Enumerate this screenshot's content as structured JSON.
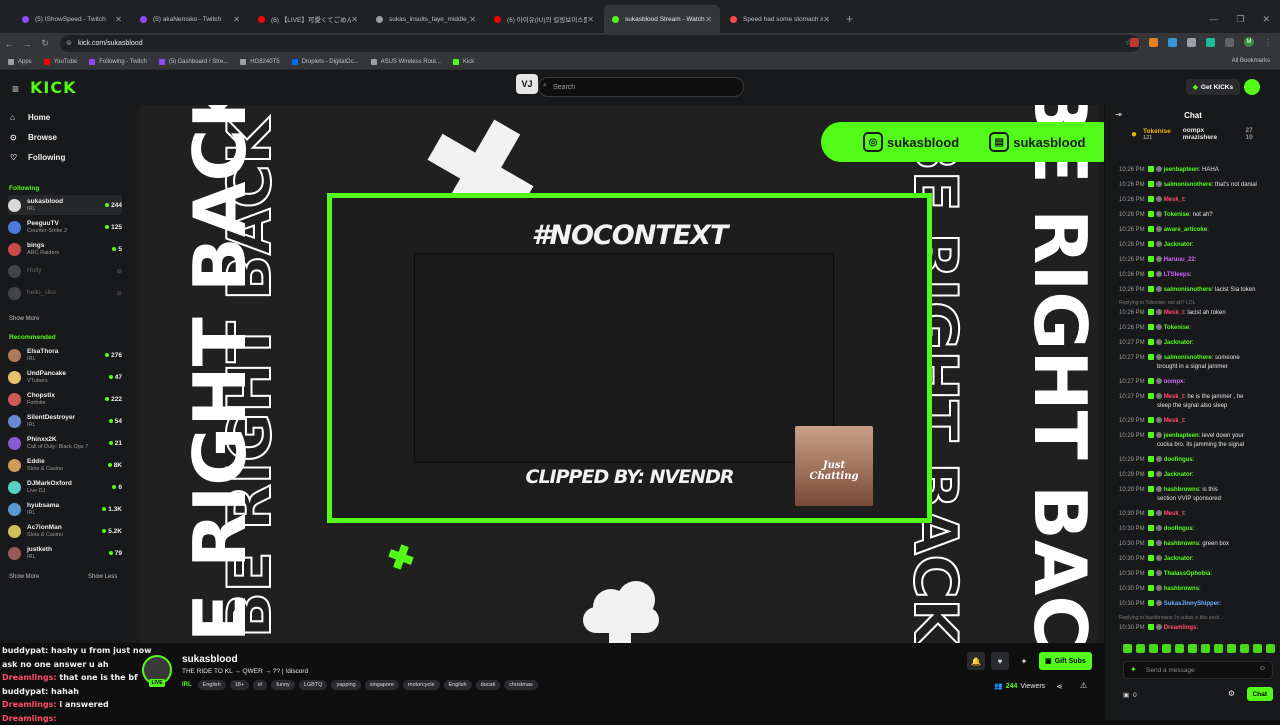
{
  "browser": {
    "tabs": [
      {
        "title": "(5) IShowSpeed - Twitch",
        "color": "#9146ff"
      },
      {
        "title": "(5) akaNemsko - Twitch",
        "color": "#9146ff"
      },
      {
        "title": "(6) 【LIVE】可愛くてごめん／花音聖...",
        "color": "#ff0000"
      },
      {
        "title": "sukas_insults_faye_middle_fing...",
        "color": "#9aa0a6"
      },
      {
        "title": "(6) 아이유(IU)의 킬링보이스를 ...",
        "color": "#ff0000"
      },
      {
        "title": "sukasblood Stream - Watch",
        "color": "#53fc18"
      },
      {
        "title": "Speed had some stomach issue...",
        "color": "#ff4b4b"
      }
    ],
    "url": "kick.com/sukasblood",
    "bookmarks": [
      "Apps",
      "YouTube",
      "Following - Twitch",
      "(5) Dashboard / Stre...",
      "HG8240T5",
      "Droplets - DigitalOc...",
      "ASUS Wireless Rout...",
      "Kick"
    ],
    "all_bookmarks": "All Bookmarks",
    "profile_initial": "M"
  },
  "topnav": {
    "logo": "KICK",
    "vj": "VJ",
    "search_placeholder": "Search",
    "get_kicks": "Get KICKs"
  },
  "sidebar": {
    "nav": [
      {
        "label": "Home",
        "icon": "home-icon"
      },
      {
        "label": "Browse",
        "icon": "compass-icon"
      },
      {
        "label": "Following",
        "icon": "heart-icon"
      }
    ],
    "following_title": "Following",
    "following": [
      {
        "name": "sukasblood",
        "category": "IRL",
        "viewers": "244",
        "color": "#d9d9d9"
      },
      {
        "name": "PeeguuTV",
        "category": "Counter-Strike 2",
        "viewers": "125",
        "color": "#4a7bd8"
      },
      {
        "name": "bings",
        "category": "ARC Raiders",
        "viewers": "5",
        "color": "#c84a4a"
      },
      {
        "name": "Holly",
        "category": "",
        "viewers": "",
        "color": "#888888"
      },
      {
        "name": "hello_siko",
        "category": "",
        "viewers": "",
        "color": "#888888"
      }
    ],
    "show_more": "Show More",
    "recommended_title": "Recommended",
    "recommended": [
      {
        "name": "ElsaThora",
        "category": "IRL",
        "viewers": "276",
        "color": "#b07a5a"
      },
      {
        "name": "UndPancake",
        "category": "VTubers",
        "viewers": "47",
        "color": "#e8c26a"
      },
      {
        "name": "Chopstix",
        "category": "Fortnite",
        "viewers": "222",
        "color": "#d05a5a"
      },
      {
        "name": "SilentDestroyer",
        "category": "IRL",
        "viewers": "54",
        "color": "#6a8ad0"
      },
      {
        "name": "Phinxx2K",
        "category": "Call of Duty: Black Ops 7",
        "viewers": "21",
        "color": "#8a5ad0"
      },
      {
        "name": "Eddie",
        "category": "Slots & Casino",
        "viewers": "8K",
        "color": "#d09a5a"
      },
      {
        "name": "DJMarkOxford",
        "category": "Live DJ",
        "viewers": "6",
        "color": "#5ad0c0"
      },
      {
        "name": "hyubsama",
        "category": "IRL",
        "viewers": "1.3K",
        "color": "#5a9ad0"
      },
      {
        "name": "Ac7ionMan",
        "category": "Slots & Casino",
        "viewers": "5.2K",
        "color": "#d0c05a"
      },
      {
        "name": "justketh",
        "category": "IRL",
        "viewers": "79",
        "color": "#9a5a5a"
      }
    ],
    "show_more_2": "Show More",
    "show_less": "Show Less"
  },
  "player": {
    "brb_text": "BE RIGHT BACK",
    "nocontext": "#NOCONTEXT",
    "clipped_by": "CLIPPED BY: NVENDR",
    "just_chatting": "Just Chatting",
    "social_instagram": "sukasblood",
    "social_twitch": "sukasblood"
  },
  "overlay_chat": [
    {
      "user": "buddypat:",
      "text": "hashy u from just now ask no one answer u ah",
      "user_color": "#f0f0f0"
    },
    {
      "user": "Dreamlings:",
      "text": "that one is the bf",
      "user_color": "#ff4b6b"
    },
    {
      "user": "buddypat:",
      "text": "hahah",
      "user_color": "#f0f0f0"
    },
    {
      "user": "Dreamlings:",
      "text": "i answered",
      "user_color": "#ff4b6b"
    },
    {
      "user": "Dreamlings:",
      "text": "",
      "user_color": "#ff4b6b"
    }
  ],
  "stream": {
    "live_badge": "LIVE",
    "channel": "sukasblood",
    "title": "THE RIDE TO KL → QWER → ?? | !discord",
    "category": "IRL",
    "tags": [
      "English",
      "18+",
      "irl",
      "funny",
      "LGBTQ",
      "yapping",
      "singapore",
      "motorcycle",
      "English",
      "ducati",
      "christmas"
    ],
    "gift_subs": "Gift Subs",
    "viewers": "244",
    "viewers_label": "Viewers"
  },
  "chat": {
    "title": "Chat",
    "pinned": [
      {
        "user": "Tokenise",
        "count": "121",
        "color": "#f4b400"
      },
      {
        "user": "oompx",
        "count": "27",
        "color": "#e6e6e6"
      },
      {
        "user": "mrazishere",
        "count": "10",
        "color": "#e6e6e6"
      }
    ],
    "messages": [
      {
        "type": "msg",
        "time": "10:26 PM",
        "user": "jeenbapteen",
        "color": "#53fc18",
        "text": "HAHA"
      },
      {
        "type": "msg",
        "time": "10:26 PM",
        "user": "salmonisnothere",
        "color": "#53fc18",
        "text": "that's not danial"
      },
      {
        "type": "msg",
        "time": "10:26 PM",
        "user": "Mesk_t",
        "color": "#ff4b6b",
        "text": ""
      },
      {
        "type": "msg",
        "time": "10:26 PM",
        "user": "Tokenise",
        "color": "#53fc18",
        "text": "not ah?"
      },
      {
        "type": "msg",
        "time": "10:26 PM",
        "user": "aware_articoke",
        "color": "#53fc18",
        "text": ""
      },
      {
        "type": "msg",
        "time": "10:26 PM",
        "user": "Jacknator",
        "color": "#53fc18",
        "text": ""
      },
      {
        "type": "msg",
        "time": "10:26 PM",
        "user": "Haruuu_22",
        "color": "#d06aff",
        "text": ""
      },
      {
        "type": "msg",
        "time": "10:26 PM",
        "user": "LTSleeps",
        "color": "#d06aff",
        "text": ""
      },
      {
        "type": "msg",
        "time": "10:26 PM",
        "user": "salmonisnothere",
        "color": "#53fc18",
        "text": "lacist Sia token"
      },
      {
        "type": "reply",
        "text": "Replying to Tokenise: not ah? LOL"
      },
      {
        "type": "msg",
        "time": "10:26 PM",
        "user": "Mesk_t",
        "color": "#ff4b6b",
        "text": "lacist ah token"
      },
      {
        "type": "msg",
        "time": "10:26 PM",
        "user": "Tokenise",
        "color": "#53fc18",
        "text": ""
      },
      {
        "type": "msg",
        "time": "10:27 PM",
        "user": "Jacknator",
        "color": "#53fc18",
        "text": ""
      },
      {
        "type": "msg",
        "time": "10:27 PM",
        "user": "salmonisnothere",
        "color": "#53fc18",
        "text": "someone"
      },
      {
        "type": "cont",
        "text": "brought in a signal jammer"
      },
      {
        "type": "msg",
        "time": "10:27 PM",
        "user": "oompx",
        "color": "#d06aff",
        "text": ""
      },
      {
        "type": "msg",
        "time": "10:27 PM",
        "user": "Mesk_t",
        "color": "#ff4b6b",
        "text": "he is the jammer , he"
      },
      {
        "type": "cont",
        "text": "sleep the signal also sleep"
      },
      {
        "type": "msg",
        "time": "10:29 PM",
        "user": "Mesk_t",
        "color": "#ff4b6b",
        "text": ""
      },
      {
        "type": "msg",
        "time": "10:29 PM",
        "user": "jeenbapteen",
        "color": "#53fc18",
        "text": "level down your"
      },
      {
        "type": "cont",
        "text": "cocka bro. its jamming the signal"
      },
      {
        "type": "msg",
        "time": "10:29 PM",
        "user": "doofingus",
        "color": "#53fc18",
        "text": ""
      },
      {
        "type": "msg",
        "time": "10:29 PM",
        "user": "Jacknator",
        "color": "#53fc18",
        "text": ""
      },
      {
        "type": "msg",
        "time": "10:29 PM",
        "user": "hashbrowns",
        "color": "#53fc18",
        "text": "is this"
      },
      {
        "type": "cont",
        "text": "section VVIP sponsored"
      },
      {
        "type": "msg",
        "time": "10:30 PM",
        "user": "Mesk_t",
        "color": "#ff4b6b",
        "text": ""
      },
      {
        "type": "msg",
        "time": "10:30 PM",
        "user": "doofingus",
        "color": "#53fc18",
        "text": ""
      },
      {
        "type": "msg",
        "time": "10:30 PM",
        "user": "hashbrowns",
        "color": "#53fc18",
        "text": "green box"
      },
      {
        "type": "msg",
        "time": "10:30 PM",
        "user": "Jacknator",
        "color": "#53fc18",
        "text": ""
      },
      {
        "type": "msg",
        "time": "10:30 PM",
        "user": "ThalassOphobia",
        "color": "#53fc18",
        "text": ""
      },
      {
        "type": "msg",
        "time": "10:30 PM",
        "user": "hashbrowns",
        "color": "#53fc18",
        "text": ""
      },
      {
        "type": "msg",
        "time": "10:30 PM",
        "user": "SukasJinnyShipper",
        "color": "#6ab0ff",
        "text": ""
      },
      {
        "type": "reply",
        "text": "Replying to hashbrowns: hi sukas is this secti..."
      },
      {
        "type": "msg",
        "time": "10:30 PM",
        "user": "Dreamlings",
        "color": "#ff4b6b",
        "text": ""
      }
    ],
    "input_placeholder": "Send a message",
    "kicks_count": "0",
    "chat_button": "Chat"
  }
}
